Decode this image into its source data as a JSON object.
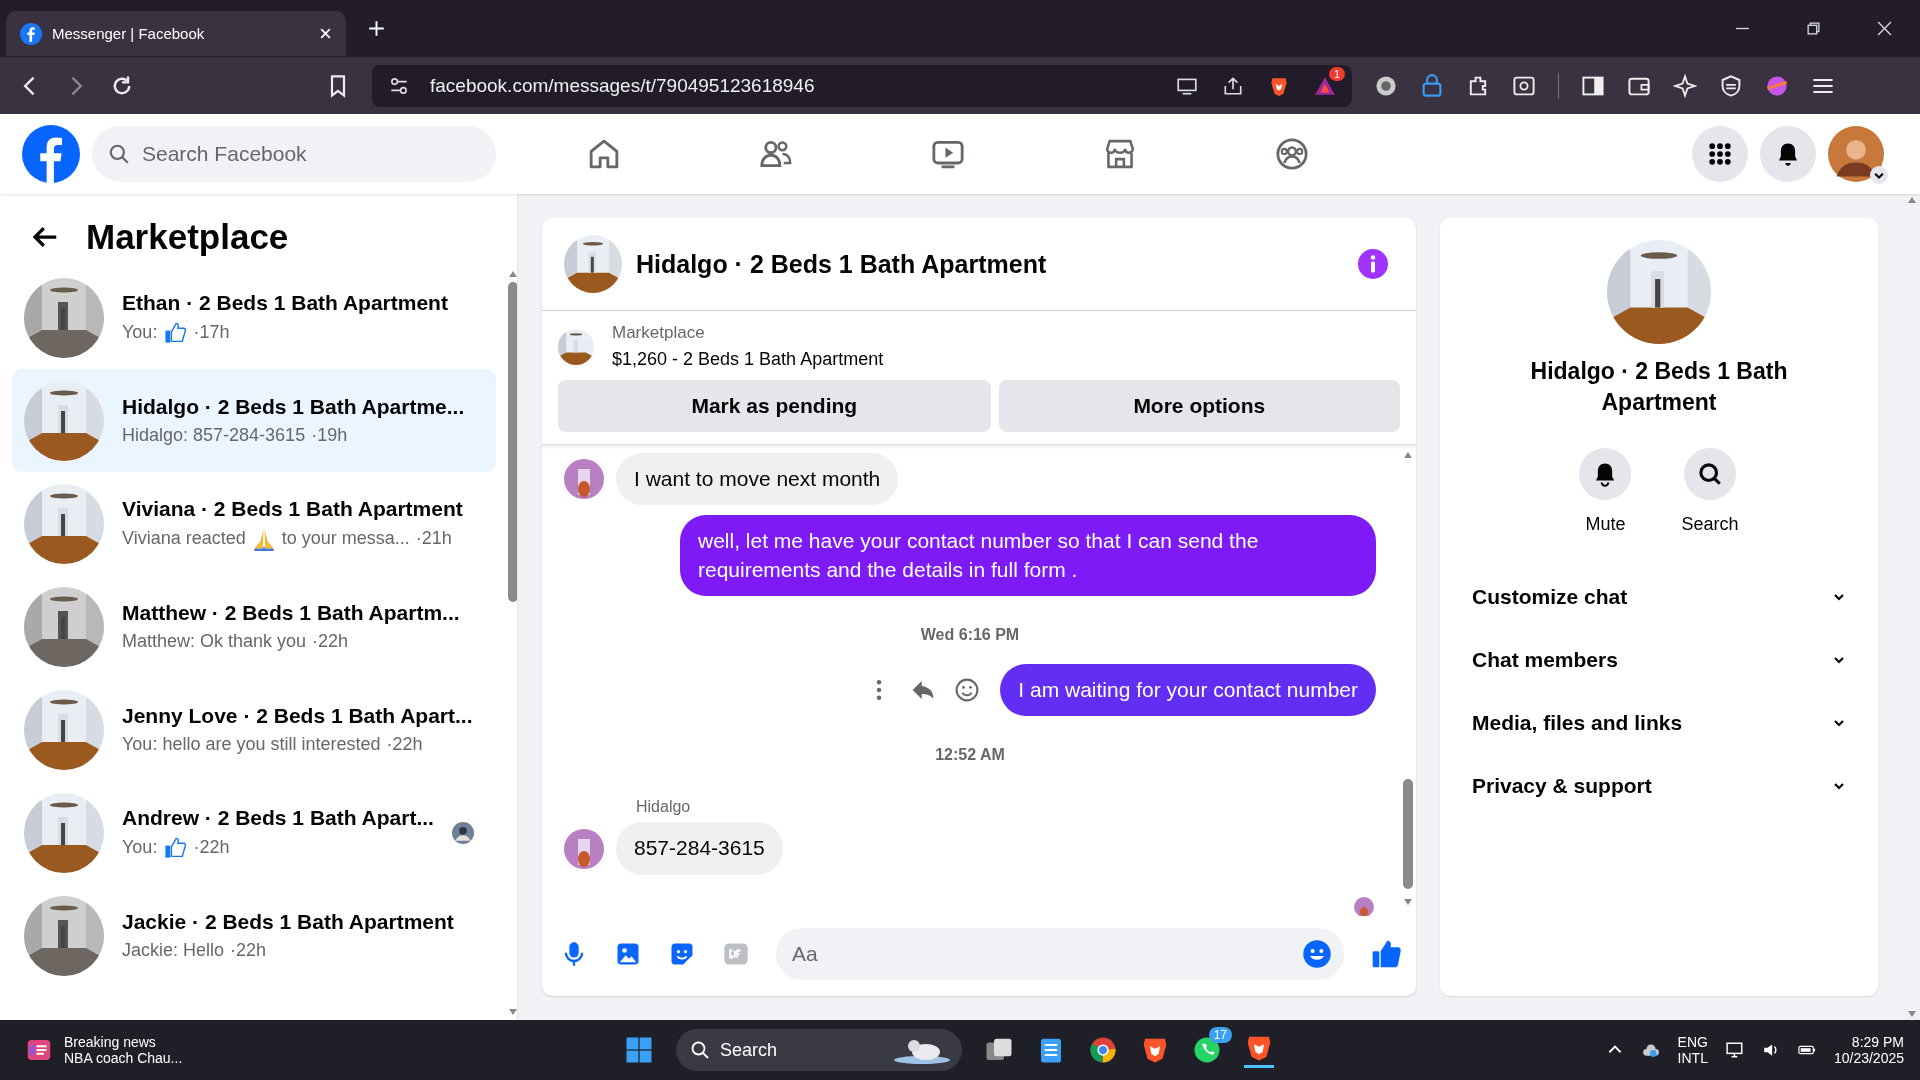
{
  "browser": {
    "tab": {
      "title": "Messenger | Facebook"
    },
    "url": "facebook.com/messages/t/790495123618946",
    "rewards_badge": "1"
  },
  "header": {
    "search": {
      "placeholder": "Search Facebook"
    }
  },
  "sidebar": {
    "title": "Marketplace",
    "conversations": [
      {
        "title": "Ethan · 2 Beds 1 Bath Apartment",
        "kind": "like",
        "preview": "You:",
        "time": "·17h",
        "selected": false,
        "seen": false
      },
      {
        "title": "Hidalgo · 2 Beds 1 Bath Apartme...",
        "kind": "text",
        "preview": "Hidalgo: 857-284-3615",
        "time": "·19h",
        "selected": true,
        "seen": false
      },
      {
        "title": "Viviana · 2 Beds 1 Bath Apartment",
        "kind": "reacted",
        "preview": "Viviana reacted",
        "preview_after": "to your messa...",
        "time": "·21h",
        "selected": false,
        "seen": false
      },
      {
        "title": "Matthew · 2 Beds 1 Bath Apartm...",
        "kind": "text",
        "preview": "Matthew: Ok thank you",
        "time": "·22h",
        "selected": false,
        "seen": false
      },
      {
        "title": "Jenny Love · 2 Beds 1 Bath Apart...",
        "kind": "text",
        "preview": "You: hello are you still interested",
        "time": "·22h",
        "selected": false,
        "seen": false
      },
      {
        "title": "Andrew · 2 Beds 1 Bath Apart...",
        "kind": "like",
        "preview": "You:",
        "time": "·22h",
        "selected": false,
        "seen": true
      },
      {
        "title": "Jackie · 2 Beds 1 Bath Apartment",
        "kind": "text",
        "preview": "Jackie: Hello",
        "time": "·22h",
        "selected": false,
        "seen": false
      }
    ]
  },
  "chat": {
    "title": "Hidalgo · 2 Beds 1 Bath Apartment",
    "listing": {
      "source": "Marketplace",
      "summary": "$1,260 - 2 Beds 1 Bath Apartment"
    },
    "buttons": [
      "Mark as pending",
      "More options"
    ],
    "messages": [
      {
        "kind": "received",
        "text": "I want to move next month"
      },
      {
        "kind": "sent",
        "text": "well, let me have your contact number so that I can send the requirements and the details in full form .",
        "hover_actions": false
      },
      {
        "kind": "time",
        "text": "Wed 6:16 PM"
      },
      {
        "kind": "sent",
        "text": "I am waiting for your contact number",
        "hover_actions": true
      },
      {
        "kind": "time",
        "text": "12:52 AM"
      },
      {
        "kind": "received",
        "sender": "Hidalgo",
        "text": "857-284-3615"
      }
    ],
    "seen": true,
    "composer": {
      "placeholder": "Aa"
    }
  },
  "info": {
    "title": "Hidalgo · 2 Beds 1 Bath Apartment",
    "actions": [
      {
        "kind": "mute",
        "label": "Mute"
      },
      {
        "kind": "search",
        "label": "Search"
      }
    ],
    "sections": [
      {
        "label": "Customize chat",
        "expanded": false
      },
      {
        "label": "Chat members",
        "expanded": false
      },
      {
        "label": "Media, files and links",
        "expanded": false
      },
      {
        "label": "Privacy & support",
        "expanded": false
      }
    ]
  },
  "taskbar": {
    "news": {
      "title": "Breaking news",
      "headline": "NBA coach Chau..."
    },
    "search": "Search",
    "whatsapp_badge": "17",
    "language": "ENG",
    "layout": "INTL",
    "time": "8:29 PM",
    "date": "10/23/2025"
  }
}
